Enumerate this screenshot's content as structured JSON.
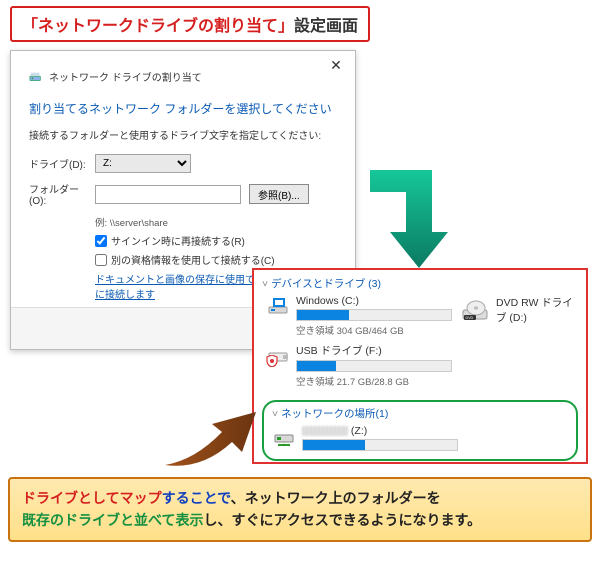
{
  "title_badge": {
    "accent": "「ネットワークドライブの割り当て」",
    "rest": "設定画面"
  },
  "dialog": {
    "window_title": "ネットワーク ドライブの割り当て",
    "heading": "割り当てるネットワーク フォルダーを選択してください",
    "subheading": "接続するフォルダーと使用するドライブ文字を指定してください:",
    "drive_label": "ドライブ(D):",
    "drive_value": "Z:",
    "folder_label": "フォルダー(O):",
    "folder_value": "",
    "browse_label": "参照(B)...",
    "example": "例: \\\\server\\share",
    "reconnect_label": "サインイン時に再接続する(R)",
    "reconnect_checked": true,
    "othercred_label": "別の資格情報を使用して接続する(C)",
    "othercred_checked": false,
    "webdav_link": "ドキュメントと画像の保存に使用できる Web サイトに接続します"
  },
  "explorer": {
    "devices_header": "デバイスとドライブ (3)",
    "drives": [
      {
        "name": "Windows (C:)",
        "free": "空き領域 304 GB/464 GB",
        "fill_pct": 34
      },
      {
        "name": "USB ドライブ (F:)",
        "free": "空き領域 21.7 GB/28.8 GB",
        "fill_pct": 25
      }
    ],
    "dvd_name": "DVD RW ドライブ (D:)",
    "network_header": "ネットワークの場所(1)",
    "network_item": {
      "letter": "(Z:)",
      "fill_pct": 40
    }
  },
  "note": {
    "t1": "ドライブとしてマップ",
    "t2": "することで",
    "t3": "、ネットワーク上のフォルダーを",
    "t4": "既存のドライブと並べて表示",
    "t5": "し、すぐにアクセスできるようになります。"
  }
}
